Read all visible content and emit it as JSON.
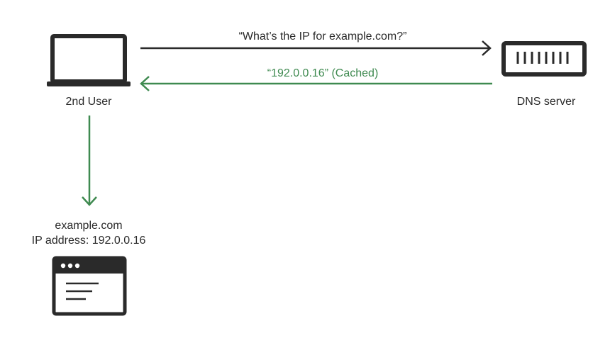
{
  "colors": {
    "ink": "#2a2a2a",
    "accent_green": "#3f8a50",
    "background": "#ffffff"
  },
  "nodes": {
    "user": {
      "label": "2nd User",
      "icon": "laptop-icon"
    },
    "dns": {
      "label": "DNS server",
      "icon": "server-icon"
    },
    "browser": {
      "icon": "browser-window-icon",
      "domain": "example.com",
      "ip_label": "IP address:",
      "ip_value": "192.0.0.16"
    }
  },
  "edges": {
    "query": {
      "label": "“What’s the IP for example.com?”",
      "from": "user",
      "to": "dns"
    },
    "response": {
      "label": "“192.0.0.16” (Cached)",
      "from": "dns",
      "to": "user"
    },
    "resolve": {
      "from": "user",
      "to": "browser"
    }
  }
}
